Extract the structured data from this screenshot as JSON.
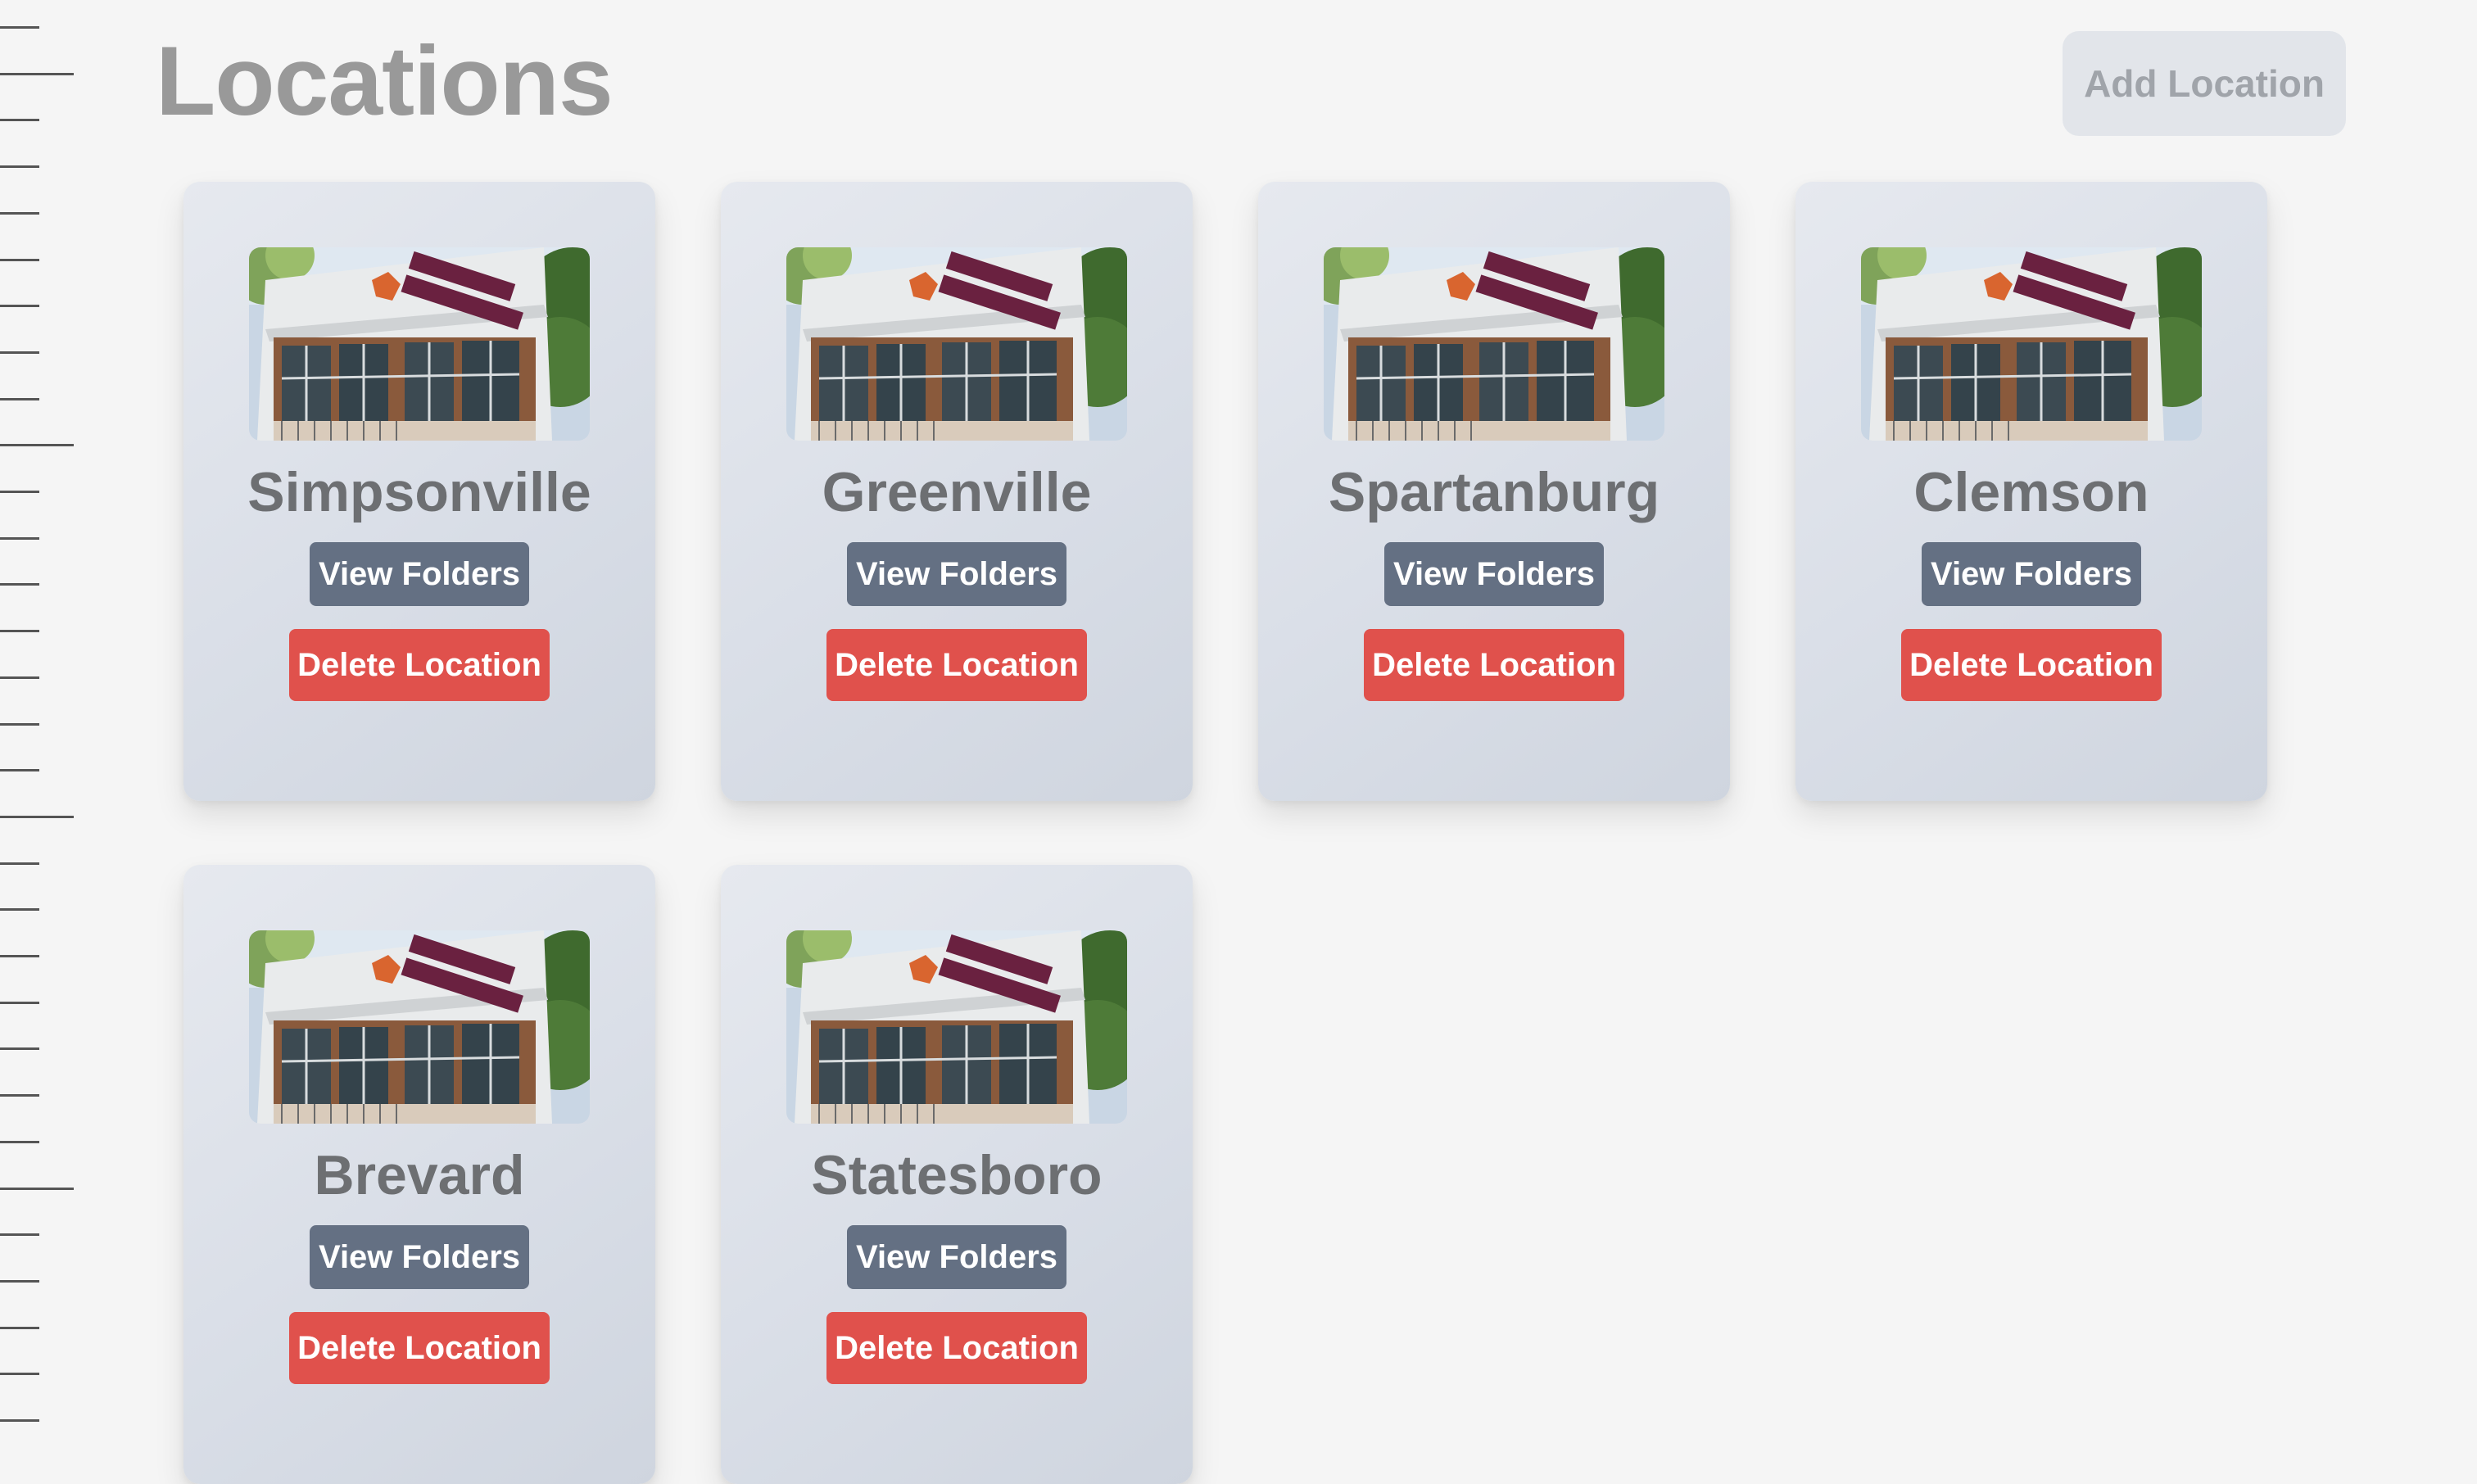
{
  "page": {
    "title": "Locations",
    "add_button_label": "Add Location"
  },
  "locations": [
    {
      "name": "Simpsonville",
      "view_label": "View Folders",
      "delete_label": "Delete Location",
      "image_icon": "storefront-photo"
    },
    {
      "name": "Greenville",
      "view_label": "View Folders",
      "delete_label": "Delete Location",
      "image_icon": "storefront-photo"
    },
    {
      "name": "Spartanburg",
      "view_label": "View Folders",
      "delete_label": "Delete Location",
      "image_icon": "storefront-photo"
    },
    {
      "name": "Clemson",
      "view_label": "View Folders",
      "delete_label": "Delete Location",
      "image_icon": "storefront-photo"
    },
    {
      "name": "Brevard",
      "view_label": "View Folders",
      "delete_label": "Delete Location",
      "image_icon": "storefront-photo"
    },
    {
      "name": "Statesboro",
      "view_label": "View Folders",
      "delete_label": "Delete Location",
      "image_icon": "storefront-photo"
    }
  ],
  "colors": {
    "background": "#f5f5f5",
    "view_button": "#647083",
    "delete_button": "#e0514c",
    "add_button": "#e2e5ea"
  }
}
